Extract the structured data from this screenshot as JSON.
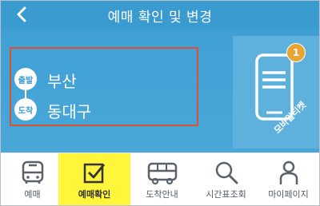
{
  "header": {
    "title": "예매 확인 및 변경"
  },
  "route": {
    "departure": {
      "badge": "출발",
      "name": "부산"
    },
    "arrival": {
      "badge": "도착",
      "name": "동대구"
    }
  },
  "mobile_ticket": {
    "label": "모바일티켓",
    "badge_count": "1"
  },
  "tabs": [
    {
      "label": "예매",
      "icon": "bus-icon",
      "active": false
    },
    {
      "label": "예매확인",
      "icon": "checkbox-icon",
      "active": true
    },
    {
      "label": "도착안내",
      "icon": "bus-arrival-icon",
      "active": false
    },
    {
      "label": "시간표조회",
      "icon": "search-icon",
      "active": false
    },
    {
      "label": "마이페이지",
      "icon": "person-icon",
      "active": false
    }
  ],
  "colors": {
    "primary": "#3a9bd0",
    "active_tab": "#fff53b",
    "highlight_border": "#d9532f",
    "badge": "#e8a534"
  }
}
